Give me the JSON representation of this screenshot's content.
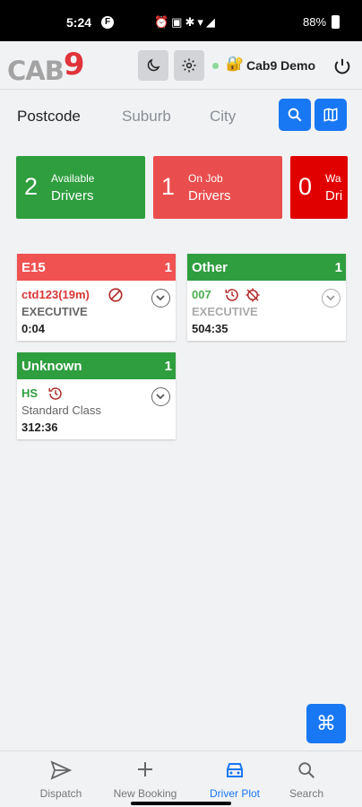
{
  "status_bar": {
    "time": "5:24",
    "battery": "88%"
  },
  "header": {
    "logo_text": "CAB",
    "logo_accent": "9",
    "user_name": "Cab9 Demo",
    "online": true
  },
  "tabs": [
    {
      "label": "Postcode",
      "active": true
    },
    {
      "label": "Suburb",
      "active": false
    },
    {
      "label": "City",
      "active": false
    }
  ],
  "summary": [
    {
      "count": "2",
      "line1": "Available",
      "line2": "Drivers",
      "color": "#2e9e3e"
    },
    {
      "count": "1",
      "line1": "On Job",
      "line2": "Drivers",
      "color": "#ea4d4d"
    },
    {
      "count": "0",
      "line1": "Wa",
      "line2": "Dri",
      "color": "#e00000"
    }
  ],
  "zones": [
    {
      "name": "E15",
      "count": "1",
      "color": "#f05252",
      "driver": {
        "name": "ctd123(19m)",
        "name_color": "#d93636",
        "vehicle": "EXECUTIVE",
        "vehicle_color": "#666666",
        "time": "0:04",
        "icons": [
          "blocked-icon"
        ]
      }
    },
    {
      "name": "Other",
      "count": "1",
      "color": "#2e9e3e",
      "driver": {
        "name": "007",
        "name_color": "#4caf50",
        "vehicle": "EXECUTIVE",
        "vehicle_color": "#aaaaaa",
        "time": "504:35",
        "icons": [
          "history-icon",
          "no-location-icon"
        ]
      }
    },
    {
      "name": "Unknown",
      "count": "1",
      "color": "#2e9e3e",
      "driver": {
        "name": "HS",
        "name_color": "#2e9e3e",
        "vehicle": "Standard Class",
        "vehicle_color": "#666666",
        "time": "312:36",
        "icons": [
          "history-icon"
        ]
      }
    }
  ],
  "fab_icon": "⌘",
  "bottom_nav": [
    {
      "label": "Dispatch",
      "icon": "send-icon",
      "active": false
    },
    {
      "label": "New Booking",
      "icon": "plus-icon",
      "active": false
    },
    {
      "label": "Driver Plot",
      "icon": "car-icon",
      "active": true
    },
    {
      "label": "Search",
      "icon": "search-icon",
      "active": false
    }
  ],
  "colors": {
    "primary": "#1877f2",
    "danger": "#ea4d4d",
    "success": "#2e9e3e"
  }
}
